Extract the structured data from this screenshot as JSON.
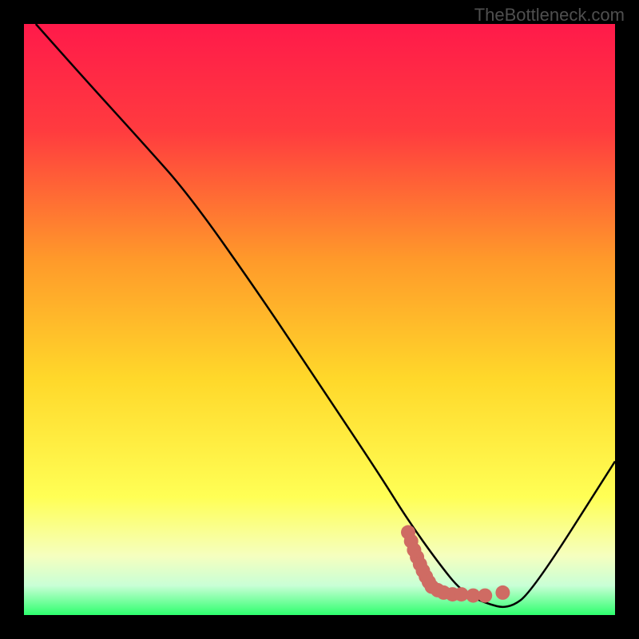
{
  "watermark": "TheBottleneck.com",
  "chart_data": {
    "type": "line",
    "title": "",
    "xlabel": "",
    "ylabel": "",
    "xlim": [
      0,
      100
    ],
    "ylim": [
      0,
      100
    ],
    "gradient_stops": [
      {
        "offset": 0,
        "color": "#ff1a4a"
      },
      {
        "offset": 18,
        "color": "#ff3b3f"
      },
      {
        "offset": 40,
        "color": "#ff9a2a"
      },
      {
        "offset": 60,
        "color": "#ffd82a"
      },
      {
        "offset": 80,
        "color": "#ffff55"
      },
      {
        "offset": 90,
        "color": "#f5ffbf"
      },
      {
        "offset": 95,
        "color": "#c9ffd6"
      },
      {
        "offset": 100,
        "color": "#2eff6e"
      }
    ],
    "series": [
      {
        "name": "bottleneck-curve",
        "color": "#000000",
        "x": [
          2,
          10,
          20,
          28,
          40,
          50,
          60,
          65,
          70,
          74,
          78,
          82,
          86,
          100
        ],
        "y": [
          100,
          91,
          80,
          71,
          54,
          39,
          24,
          16,
          9,
          4,
          2,
          1,
          4,
          26
        ]
      }
    ],
    "markers": {
      "name": "highlight-points",
      "color": "#cf6b63",
      "points": [
        {
          "x": 65.0,
          "y": 14.0
        },
        {
          "x": 65.5,
          "y": 12.5
        },
        {
          "x": 66.0,
          "y": 11.0
        },
        {
          "x": 66.5,
          "y": 9.8
        },
        {
          "x": 67.0,
          "y": 8.6
        },
        {
          "x": 67.5,
          "y": 7.5
        },
        {
          "x": 68.0,
          "y": 6.5
        },
        {
          "x": 68.5,
          "y": 5.6
        },
        {
          "x": 69.0,
          "y": 4.8
        },
        {
          "x": 70.0,
          "y": 4.2
        },
        {
          "x": 71.0,
          "y": 3.8
        },
        {
          "x": 72.5,
          "y": 3.5
        },
        {
          "x": 74.0,
          "y": 3.5
        },
        {
          "x": 76.0,
          "y": 3.3
        },
        {
          "x": 78.0,
          "y": 3.3
        },
        {
          "x": 81.0,
          "y": 3.8
        }
      ]
    }
  }
}
